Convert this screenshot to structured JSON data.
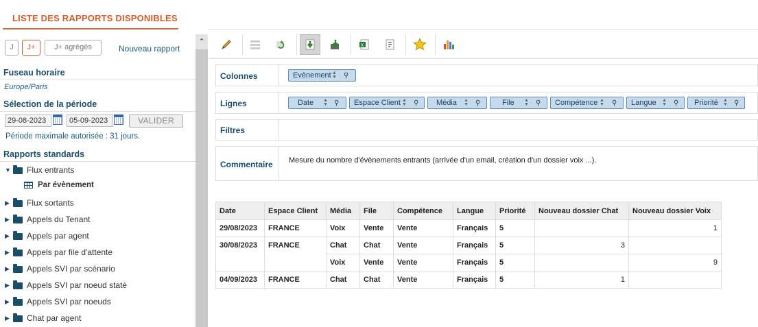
{
  "header": {
    "title": "LISTE DES RAPPORTS DISPONIBLES"
  },
  "controls": {
    "j_label": "J",
    "jplus_label": "J+",
    "jagg_label": "J+ agrégés",
    "new_report": "Nouveau rapport"
  },
  "timezone": {
    "label": "Fuseau horaire",
    "value": "Europe/Paris"
  },
  "period": {
    "label": "Sélection de la période",
    "from": "29-08-2023",
    "to": "05-09-2023",
    "validate": "VALIDER",
    "max": "Période maximale autorisée : 31 jours."
  },
  "tree": {
    "label": "Rapports standards",
    "items": [
      "Flux entrants",
      "Flux sortants",
      "Appels du Tenant",
      "Appels par agent",
      "Appels par file d'attente",
      "Appels SVI par scénario",
      "Appels SVI par noeud staté",
      "Appels SVI par noeuds",
      "Chat par agent"
    ],
    "sub_item": "Par évènement"
  },
  "icons": {
    "edit": "pencil-icon",
    "star": "star-icon",
    "chart": "bar-chart-icon"
  },
  "config": {
    "columns_label": "Colonnes",
    "columns": [
      "Evènement"
    ],
    "rows_label": "Lignes",
    "rows": [
      "Date",
      "Espace Client",
      "Média",
      "File",
      "Compétence",
      "Langue",
      "Priorité"
    ],
    "filters_label": "Filtres",
    "comment_label": "Commentaire",
    "comment": "Mesure du nombre d'évènements entrants (arrivée d'un email, création d'un dossier voix ...)."
  },
  "table": {
    "headers": [
      "Date",
      "Espace Client",
      "Média",
      "File",
      "Compétence",
      "Langue",
      "Priorité",
      "Nouveau dossier Chat",
      "Nouveau dossier Voix"
    ],
    "rows": [
      [
        "29/08/2023",
        "FRANCE",
        "Voix",
        "Vente",
        "Vente",
        "Français",
        "5",
        "",
        "1"
      ],
      [
        "30/08/2023",
        "FRANCE",
        "Chat",
        "Chat",
        "Vente",
        "Français",
        "5",
        "3",
        ""
      ],
      [
        "",
        "",
        "Voix",
        "Vente",
        "Vente",
        "Français",
        "5",
        "",
        "9"
      ],
      [
        "04/09/2023",
        "FRANCE",
        "Chat",
        "Chat",
        "Vente",
        "Français",
        "5",
        "1",
        ""
      ]
    ]
  },
  "colors": {
    "accent": "#d35b2a",
    "navy": "#1b4d66",
    "chip": "#c6daee"
  }
}
